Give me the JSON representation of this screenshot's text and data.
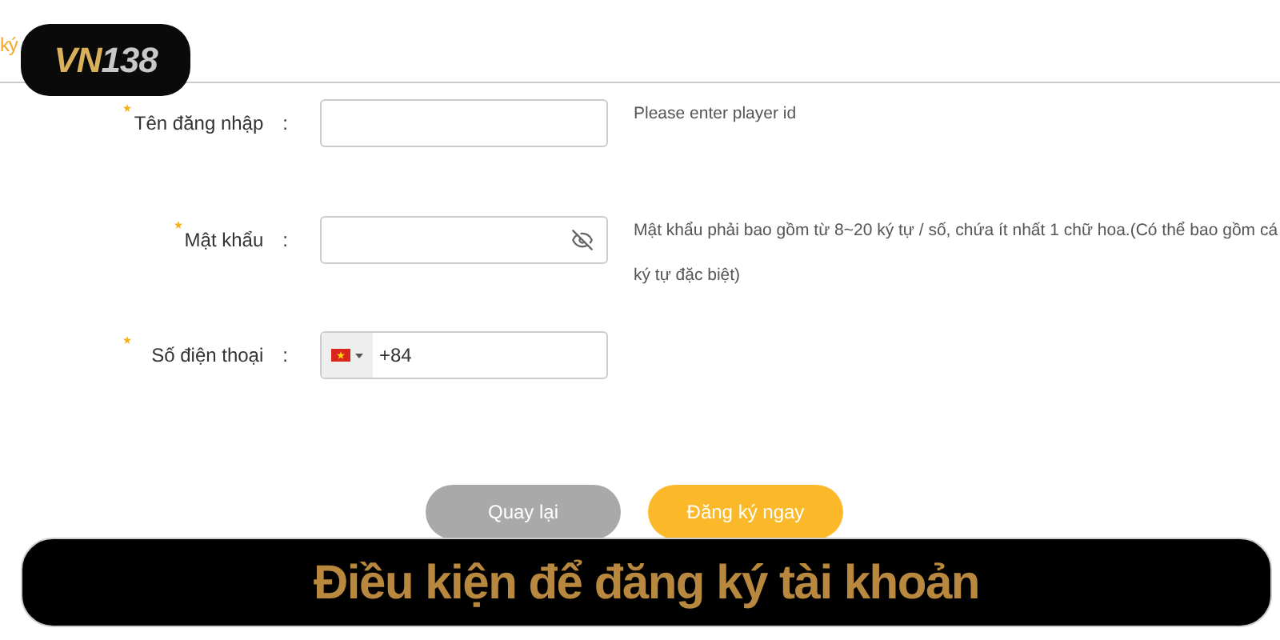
{
  "header": {
    "title": "ký",
    "logo": {
      "part_1": "VN",
      "part_2": "138"
    }
  },
  "fields": [
    {
      "kind": "text",
      "label": "Tên đăng nhập",
      "required": true,
      "colon": ":",
      "hint_lines": [
        "Please enter player id"
      ]
    },
    {
      "kind": "password",
      "label": "Mật khẩu",
      "required": true,
      "colon": ":",
      "hint_lines": [
        "Mật khẩu phải bao gồm từ 8~20 ký tự / số, chứa ít nhất 1 chữ hoa.(Có thể bao gồm cá",
        "ký tự đặc biệt)"
      ]
    },
    {
      "kind": "phone",
      "label": "Số điện thoại",
      "required": true,
      "colon": ":",
      "value": "+84"
    }
  ],
  "buttons": [
    {
      "label": "Quay lại",
      "kind": "secondary"
    },
    {
      "label": "Đăng ký ngay",
      "kind": "primary"
    }
  ],
  "banner": {
    "title": "Điều kiện để đăng ký tài khoản"
  }
}
